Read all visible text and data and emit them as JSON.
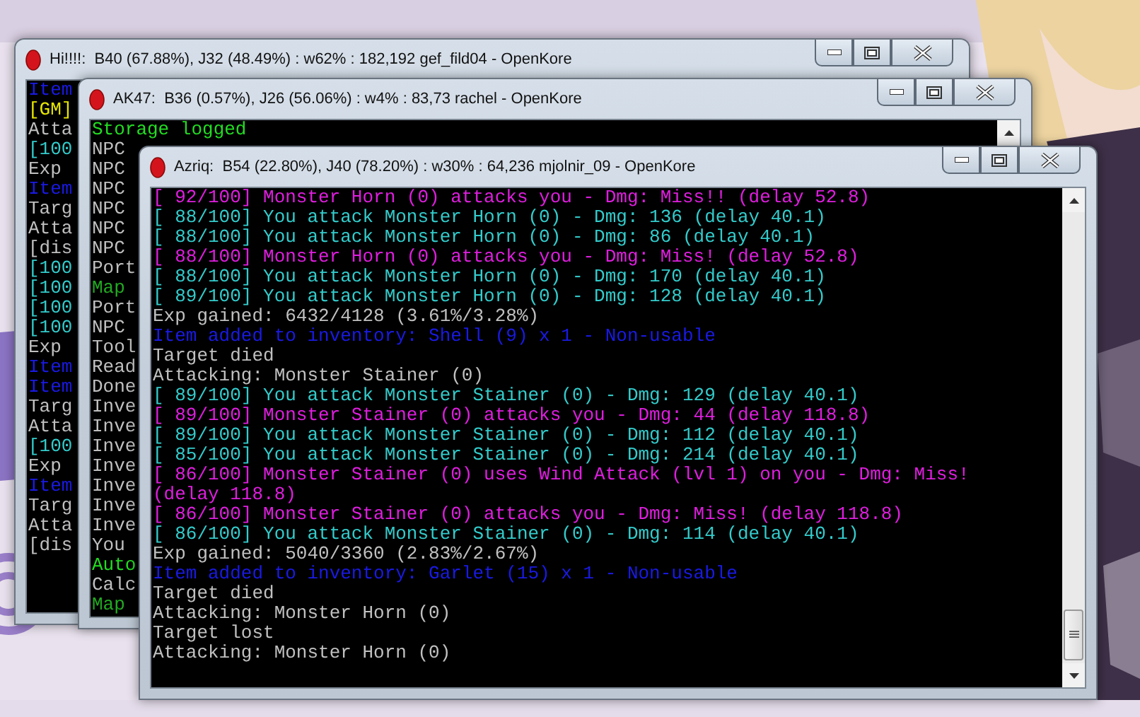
{
  "windows": [
    {
      "title": "Hi!!!!:  B40 (67.88%), J32 (48.49%) : w62% : 182,192 gef_fild04 - OpenKore",
      "lines": [
        {
          "text": "Item",
          "color": "#1a1ae6"
        },
        {
          "text": "[GM]",
          "color": "#e6e600"
        },
        {
          "text": "Atta",
          "color": "#c0c0c0"
        },
        {
          "text": "[100",
          "color": "#33cccc"
        },
        {
          "text": "Exp",
          "color": "#c0c0c0"
        },
        {
          "text": "Item",
          "color": "#1a1ae6"
        },
        {
          "text": "Targ",
          "color": "#c0c0c0"
        },
        {
          "text": "Atta",
          "color": "#c0c0c0"
        },
        {
          "text": "[dis",
          "color": "#c0c0c0"
        },
        {
          "text": "[100",
          "color": "#33cccc"
        },
        {
          "text": "[100",
          "color": "#33cccc"
        },
        {
          "text": "[100",
          "color": "#33cccc"
        },
        {
          "text": "[100",
          "color": "#33cccc"
        },
        {
          "text": "Exp",
          "color": "#c0c0c0"
        },
        {
          "text": "Item",
          "color": "#1a1ae6"
        },
        {
          "text": "Item",
          "color": "#1a1ae6"
        },
        {
          "text": "Targ",
          "color": "#c0c0c0"
        },
        {
          "text": "Atta",
          "color": "#c0c0c0"
        },
        {
          "text": "[100",
          "color": "#33cccc"
        },
        {
          "text": "Exp",
          "color": "#c0c0c0"
        },
        {
          "text": "Item",
          "color": "#1a1ae6"
        },
        {
          "text": "Targ",
          "color": "#c0c0c0"
        },
        {
          "text": "Atta",
          "color": "#c0c0c0"
        },
        {
          "text": "[dis",
          "color": "#c0c0c0"
        }
      ]
    },
    {
      "title": "AK47:  B36 (0.57%), J26 (56.06%) : w4% : 83,73 rachel - OpenKore",
      "lines": [
        {
          "text": "Storage logged",
          "color": "#22dd22"
        },
        {
          "text": "NPC",
          "color": "#c0c0c0"
        },
        {
          "text": "NPC",
          "color": "#c0c0c0"
        },
        {
          "text": "NPC",
          "color": "#c0c0c0"
        },
        {
          "text": "NPC",
          "color": "#c0c0c0"
        },
        {
          "text": "NPC",
          "color": "#c0c0c0"
        },
        {
          "text": "NPC",
          "color": "#c0c0c0"
        },
        {
          "text": "Port",
          "color": "#c0c0c0"
        },
        {
          "text": "Map",
          "color": "#22aa22"
        },
        {
          "text": "Port",
          "color": "#c0c0c0"
        },
        {
          "text": "NPC",
          "color": "#c0c0c0"
        },
        {
          "text": "Tool",
          "color": "#c0c0c0"
        },
        {
          "text": "Read",
          "color": "#c0c0c0"
        },
        {
          "text": "Done",
          "color": "#c0c0c0"
        },
        {
          "text": "Inve",
          "color": "#c0c0c0"
        },
        {
          "text": "Inve",
          "color": "#c0c0c0"
        },
        {
          "text": "Inve",
          "color": "#c0c0c0"
        },
        {
          "text": "Inve",
          "color": "#c0c0c0"
        },
        {
          "text": "Inve",
          "color": "#c0c0c0"
        },
        {
          "text": "Inve",
          "color": "#c0c0c0"
        },
        {
          "text": "Inve",
          "color": "#c0c0c0"
        },
        {
          "text": "You",
          "color": "#c0c0c0"
        },
        {
          "text": "Auto",
          "color": "#22dd22"
        },
        {
          "text": "Calc",
          "color": "#c0c0c0"
        },
        {
          "text": "Map",
          "color": "#22aa22"
        }
      ]
    },
    {
      "title": "Azriq:  B54 (22.80%), J40 (78.20%) : w30% : 64,236 mjolnir_09 - OpenKore",
      "lines": [
        {
          "text": "[ 92/100] Monster Horn (0) attacks you - Dmg: Miss!! (delay 52.8)",
          "color": "#e01ee0"
        },
        {
          "text": "[ 88/100] You attack Monster Horn (0) - Dmg: 136 (delay 40.1)",
          "color": "#33cccc"
        },
        {
          "text": "[ 88/100] You attack Monster Horn (0) - Dmg: 86 (delay 40.1)",
          "color": "#33cccc"
        },
        {
          "text": "[ 88/100] Monster Horn (0) attacks you - Dmg: Miss! (delay 52.8)",
          "color": "#e01ee0"
        },
        {
          "text": "[ 88/100] You attack Monster Horn (0) - Dmg: 170 (delay 40.1)",
          "color": "#33cccc"
        },
        {
          "text": "[ 89/100] You attack Monster Horn (0) - Dmg: 128 (delay 40.1)",
          "color": "#33cccc"
        },
        {
          "text": "Exp gained: 6432/4128 (3.61%/3.28%)",
          "color": "#c0c0c0"
        },
        {
          "text": "Item added to inventory: Shell (9) x 1 - Non-usable",
          "color": "#1a1ae6"
        },
        {
          "text": "Target died",
          "color": "#c0c0c0"
        },
        {
          "text": "Attacking: Monster Stainer (0)",
          "color": "#c0c0c0"
        },
        {
          "text": "[ 89/100] You attack Monster Stainer (0) - Dmg: 129 (delay 40.1)",
          "color": "#33cccc"
        },
        {
          "text": "[ 89/100] Monster Stainer (0) attacks you - Dmg: 44 (delay 118.8)",
          "color": "#e01ee0"
        },
        {
          "text": "[ 89/100] You attack Monster Stainer (0) - Dmg: 112 (delay 40.1)",
          "color": "#33cccc"
        },
        {
          "text": "[ 85/100] You attack Monster Stainer (0) - Dmg: 214 (delay 40.1)",
          "color": "#33cccc"
        },
        {
          "text": "[ 86/100] Monster Stainer (0) uses Wind Attack (lvl 1) on you - Dmg: Miss! (delay 118.8)",
          "color": "#e01ee0"
        },
        {
          "text": "[ 86/100] Monster Stainer (0) attacks you - Dmg: Miss! (delay 118.8)",
          "color": "#e01ee0"
        },
        {
          "text": "[ 86/100] You attack Monster Stainer (0) - Dmg: 114 (delay 40.1)",
          "color": "#33cccc"
        },
        {
          "text": "Exp gained: 5040/3360 (2.83%/2.67%)",
          "color": "#c0c0c0"
        },
        {
          "text": "Item added to inventory: Garlet (15) x 1 - Non-usable",
          "color": "#1a1ae6"
        },
        {
          "text": "Target died",
          "color": "#c0c0c0"
        },
        {
          "text": "Attacking: Monster Horn (0)",
          "color": "#c0c0c0"
        },
        {
          "text": "Target lost",
          "color": "#c0c0c0"
        },
        {
          "text": "Attacking: Monster Horn (0)",
          "color": "#c0c0c0"
        }
      ]
    }
  ]
}
